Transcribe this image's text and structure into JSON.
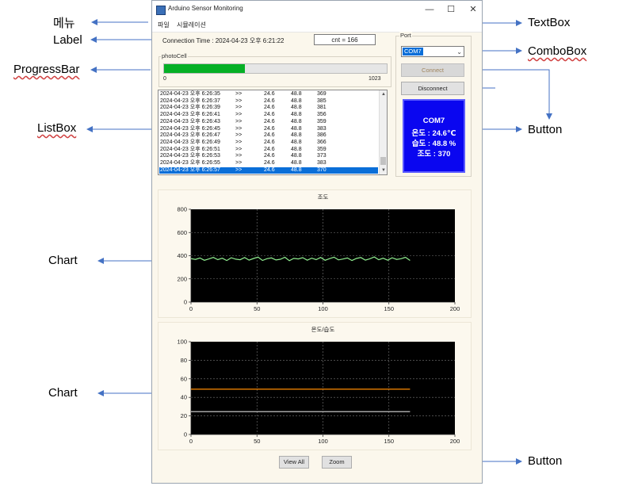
{
  "window": {
    "title": "Arduino Sensor Monitoring",
    "min": "—",
    "max": "☐",
    "close": "✕"
  },
  "menu": [
    "파일",
    "시뮬레이션"
  ],
  "connection_label": "Connection Time : 2024-04-23 오후 6:21:22",
  "cnt_text": "cnt = 166",
  "photocell": {
    "group_label": "photoCell",
    "value": 370,
    "min": "0",
    "max": "1023"
  },
  "listbox": {
    "rows": [
      {
        "time": "2024-04-23 오후 6:26:35",
        "sep": ">>",
        "temp": "24.6",
        "hum": "48.8",
        "light": "369"
      },
      {
        "time": "2024-04-23 오후 6:26:37",
        "sep": ">>",
        "temp": "24.6",
        "hum": "48.8",
        "light": "385"
      },
      {
        "time": "2024-04-23 오후 6:26:39",
        "sep": ">>",
        "temp": "24.6",
        "hum": "48.8",
        "light": "381"
      },
      {
        "time": "2024-04-23 오후 6:26:41",
        "sep": ">>",
        "temp": "24.6",
        "hum": "48.8",
        "light": "356"
      },
      {
        "time": "2024-04-23 오후 6:26:43",
        "sep": ">>",
        "temp": "24.6",
        "hum": "48.8",
        "light": "359"
      },
      {
        "time": "2024-04-23 오후 6:26:45",
        "sep": ">>",
        "temp": "24.6",
        "hum": "48.8",
        "light": "383"
      },
      {
        "time": "2024-04-23 오후 6:26:47",
        "sep": ">>",
        "temp": "24.6",
        "hum": "48.8",
        "light": "386"
      },
      {
        "time": "2024-04-23 오후 6:26:49",
        "sep": ">>",
        "temp": "24.6",
        "hum": "48.8",
        "light": "366"
      },
      {
        "time": "2024-04-23 오후 6:26:51",
        "sep": ">>",
        "temp": "24.6",
        "hum": "48.8",
        "light": "359"
      },
      {
        "time": "2024-04-23 오후 6:26:53",
        "sep": ">>",
        "temp": "24.6",
        "hum": "48.8",
        "light": "373"
      },
      {
        "time": "2024-04-23 오후 6:26:55",
        "sep": ">>",
        "temp": "24.6",
        "hum": "48.8",
        "light": "383"
      },
      {
        "time": "2024-04-23 오후 6:26:57",
        "sep": ">>",
        "temp": "24.6",
        "hum": "48.8",
        "light": "370"
      }
    ],
    "selected_index": 11
  },
  "port": {
    "group_label": "Port",
    "selected": "COM7",
    "connect_label": "Connect",
    "disconnect_label": "Disconnect"
  },
  "status": {
    "port": "COM7",
    "temp": "온도 : 24.6℃",
    "hum": "습도 : 48.8 %",
    "light": "조도 : 370"
  },
  "buttons": {
    "view_all": "View All",
    "zoom": "Zoom"
  },
  "annotations": {
    "menu": "메뉴",
    "label": "Label",
    "progressbar": "ProgressBar",
    "listbox": "ListBox",
    "chart1": "Chart",
    "chart2": "Chart",
    "textbox": "TextBox",
    "combobox": "ComboBox",
    "button1": "Button",
    "button2": "Button"
  },
  "colors": {
    "progress": "#06b025",
    "status_bg": "#0a06f0",
    "light_series": "#90ee90",
    "temp_series": "#ff8c00",
    "hum_series": "#dcdcdc",
    "arrow": "#4472c4"
  },
  "chart_data": [
    {
      "type": "line",
      "title": "조도",
      "xlim": [
        0,
        200
      ],
      "ylim": [
        0,
        800
      ],
      "xticks": [
        0,
        50,
        100,
        150,
        200
      ],
      "yticks": [
        0,
        200,
        400,
        600,
        800
      ],
      "series": [
        {
          "values": [
            375,
            368,
            380,
            360,
            372,
            385,
            366,
            378,
            358,
            382,
            370,
            365,
            384,
            362,
            376,
            388,
            359,
            374,
            381,
            363,
            369,
            386,
            357,
            377,
            372,
            383,
            361,
            379,
            366,
            385,
            360,
            375,
            387,
            364,
            371,
            380,
            358,
            376,
            384,
            362,
            373,
            389,
            365,
            378,
            361,
            382,
            368,
            374,
            386,
            359
          ]
        }
      ],
      "x_count": 166
    },
    {
      "type": "line",
      "title": "온도/습도",
      "xlim": [
        0,
        200
      ],
      "ylim": [
        0,
        100
      ],
      "xticks": [
        0,
        50,
        100,
        150,
        200
      ],
      "yticks": [
        0,
        20,
        40,
        60,
        80,
        100
      ],
      "series": [
        {
          "values": [
            48.8,
            48.8
          ],
          "x": [
            0,
            166
          ]
        },
        {
          "values": [
            24.6,
            24.6
          ],
          "x": [
            0,
            166
          ]
        }
      ]
    }
  ]
}
